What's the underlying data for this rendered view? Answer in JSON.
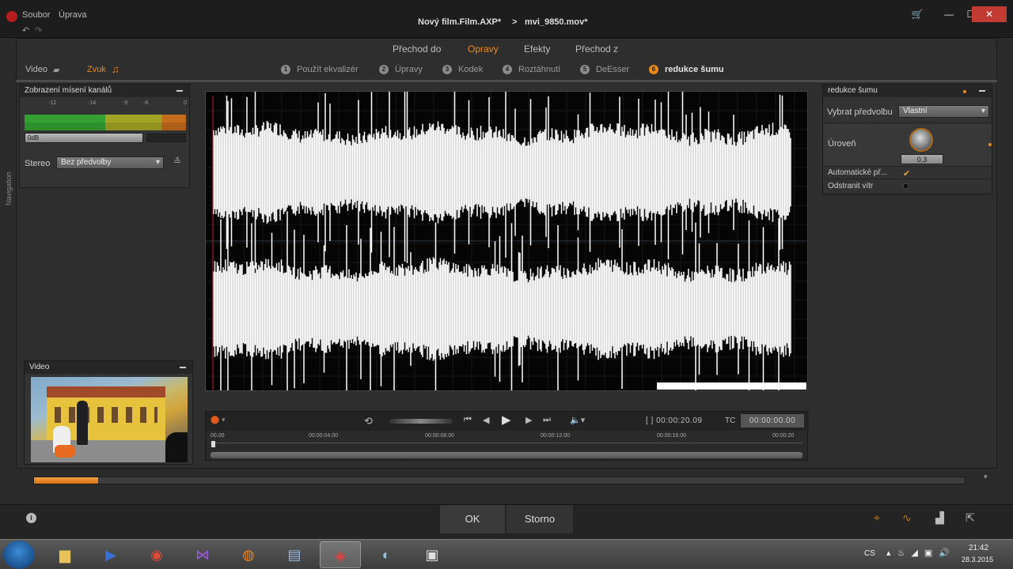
{
  "titlebar": {
    "menu": [
      "Soubor",
      "Úprava"
    ],
    "project": "Nový film.Film.AXP*",
    "separator": ">",
    "clip": "mvi_9850.mov*"
  },
  "tabs": [
    "Přechod do",
    "Opravy",
    "Efekty",
    "Přechod z"
  ],
  "active_tab": "Opravy",
  "side_tabs": {
    "video": "Video",
    "audio": "Zvuk"
  },
  "steps": [
    {
      "num": "1",
      "label": "Použít ekvalizér"
    },
    {
      "num": "2",
      "label": "Úpravy"
    },
    {
      "num": "3",
      "label": "Kodek"
    },
    {
      "num": "4",
      "label": "Roztáhnutí"
    },
    {
      "num": "5",
      "label": "DeEsser"
    },
    {
      "num": "6",
      "label": "redukce šumu"
    }
  ],
  "mixer": {
    "title": "Zobrazení mísení kanálů",
    "scale": [
      "-12",
      "-14",
      "-9",
      "-6",
      "0"
    ],
    "gain": "0dB",
    "stereo_label": "Stereo",
    "preset": "Bez předvolby"
  },
  "navigation_label": "Navigation",
  "video_panel": {
    "title": "Video"
  },
  "transport": {
    "duration": "[ ] 00:00:20.09",
    "tc_label": "TC",
    "tc_value": "00:00:00.00",
    "ruler": [
      "00.00",
      "00:00:04.00",
      "00:00:08.00",
      "00:00:12.00",
      "00:00:16.00",
      "00:00:20"
    ]
  },
  "noise": {
    "title": "redukce šumu",
    "preset_label": "Vybrat předvolbu",
    "preset_value": "Vlastní",
    "level_label": "Úroveň",
    "level_value": "0,3",
    "auto_label": "Automatické př...",
    "wind_label": "Odstranit vítr"
  },
  "progress": {
    "fill_fraction": 0.069
  },
  "bottom": {
    "ok": "OK",
    "cancel": "Storno"
  },
  "taskbar": {
    "lang": "CS",
    "time": "21:42",
    "date": "28.3.2015"
  },
  "colors": {
    "accent": "#e8891d",
    "close": "#c23b32"
  }
}
